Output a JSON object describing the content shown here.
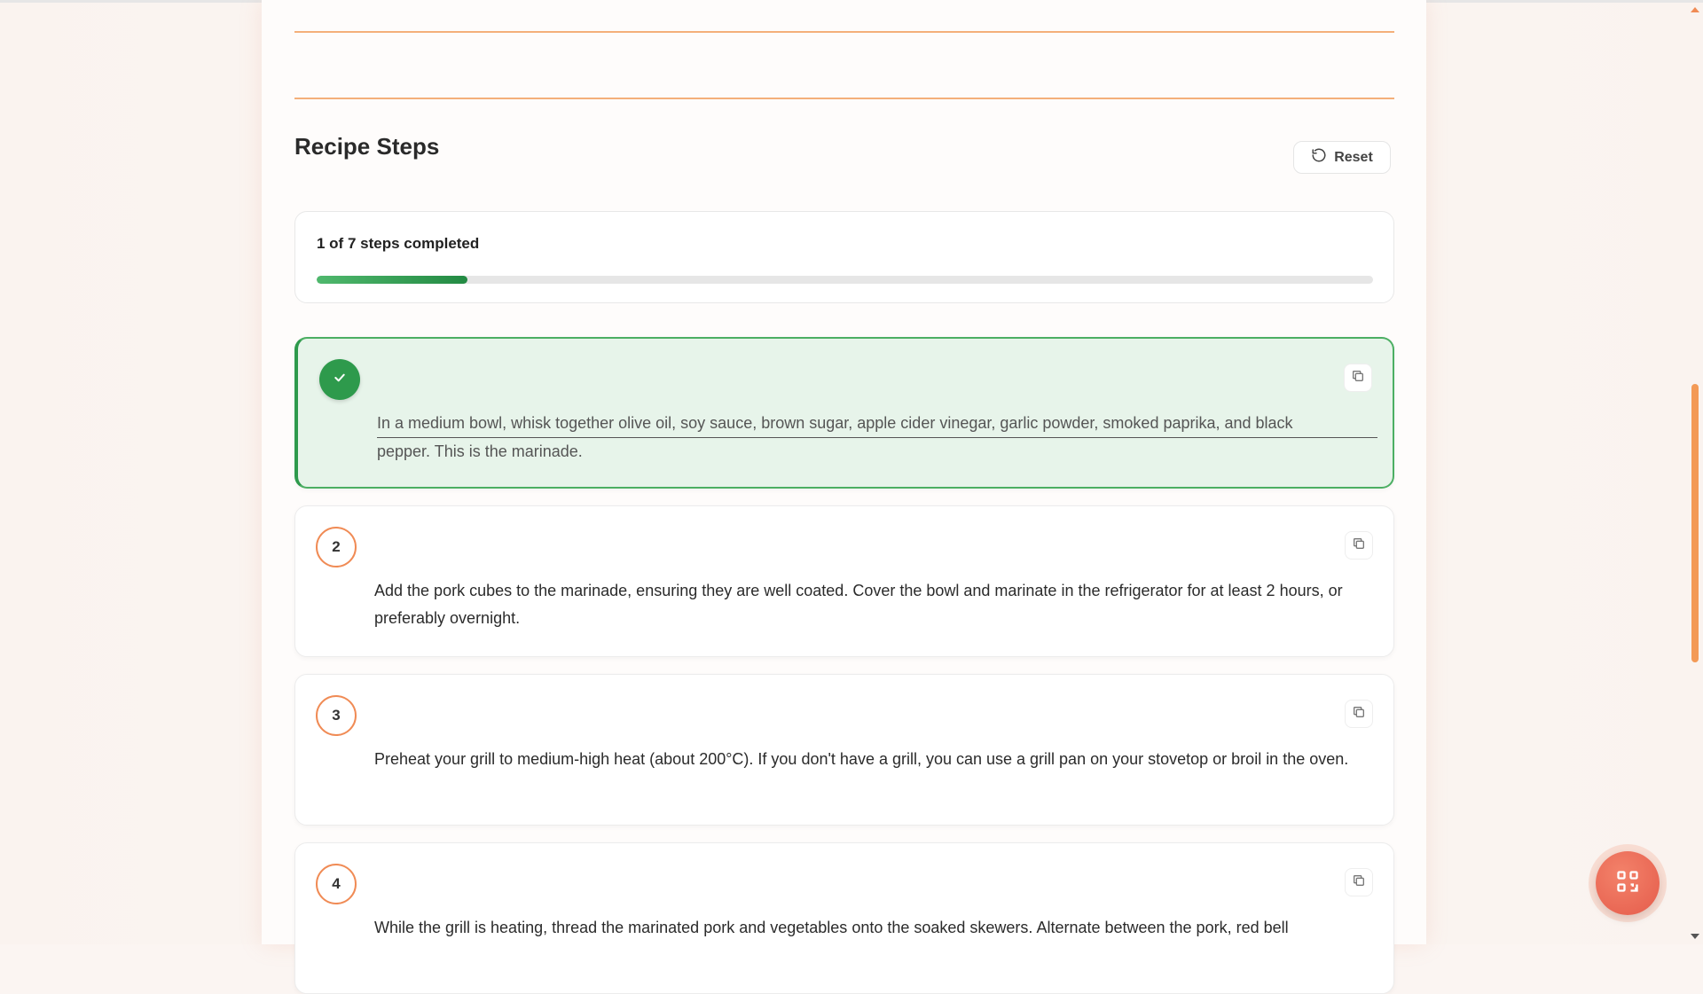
{
  "section": {
    "title": "Recipe Steps",
    "reset_label": "Reset"
  },
  "progress": {
    "text": "1 of 7 steps completed",
    "completed": 1,
    "total": 7
  },
  "steps": [
    {
      "number": "1",
      "completed": true,
      "text_line1": "In a medium bowl, whisk together olive oil, soy sauce, brown sugar, apple cider vinegar, garlic powder, smoked paprika, and black",
      "text_line2": "pepper. This is the marinade."
    },
    {
      "number": "2",
      "completed": false,
      "text": "Add the pork cubes to the marinade, ensuring they are well coated. Cover the bowl and marinate in the refrigerator for at least 2 hours, or preferably overnight."
    },
    {
      "number": "3",
      "completed": false,
      "text": "Preheat your grill to medium-high heat (about 200°C). If you don't have a grill, you can use a grill pan on your stovetop or broil in the oven."
    },
    {
      "number": "4",
      "completed": false,
      "text": "While the grill is heating, thread the marinated pork and vegetables onto the soaked skewers. Alternate between the pork, red bell"
    }
  ],
  "colors": {
    "accent": "#f08b55",
    "done_green": "#2e9a4c",
    "done_bg": "#e7f4ea",
    "fab": "#e55c4b"
  },
  "icons": {
    "reset": "refresh-icon",
    "copy": "copy-icon",
    "check": "check-icon",
    "fab": "qr-code-icon"
  }
}
